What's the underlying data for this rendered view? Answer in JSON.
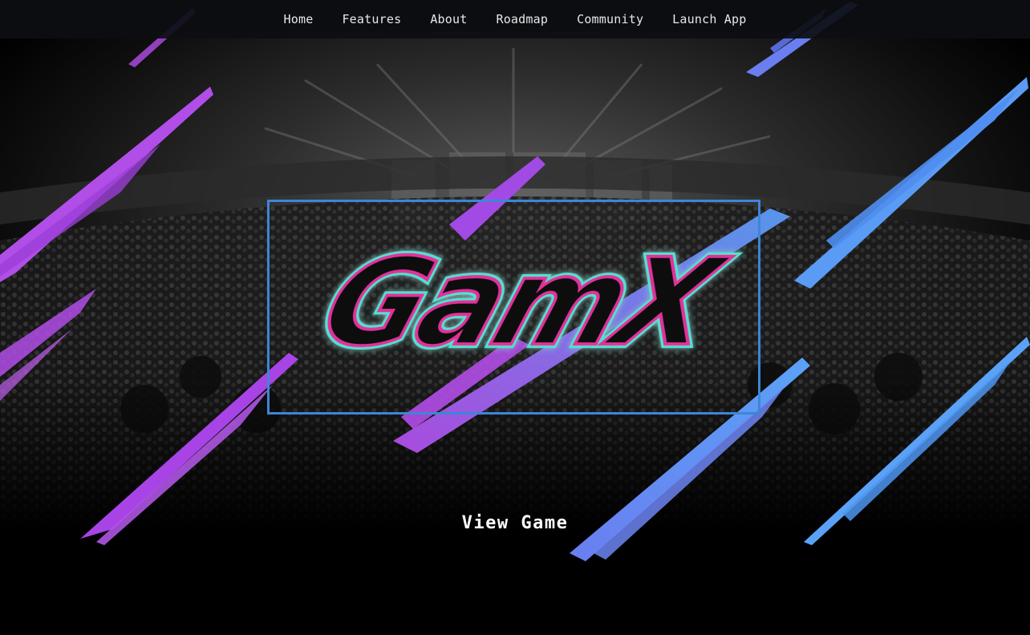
{
  "nav": {
    "items": [
      {
        "label": "Home"
      },
      {
        "label": "Features"
      },
      {
        "label": "About"
      },
      {
        "label": "Roadmap"
      },
      {
        "label": "Community"
      },
      {
        "label": "Launch App"
      }
    ]
  },
  "hero": {
    "logo_text": "GamX",
    "cta_label": "View Game"
  },
  "colors": {
    "background": "#000000",
    "nav_bg": "#0c0e12",
    "frame_border": "#3d86d6",
    "stroke_purple": "#b14ee8",
    "stroke_blue": "#5a9cf5",
    "logo_glow": "#4fe3d0",
    "logo_outline_pink": "#e0329a"
  }
}
